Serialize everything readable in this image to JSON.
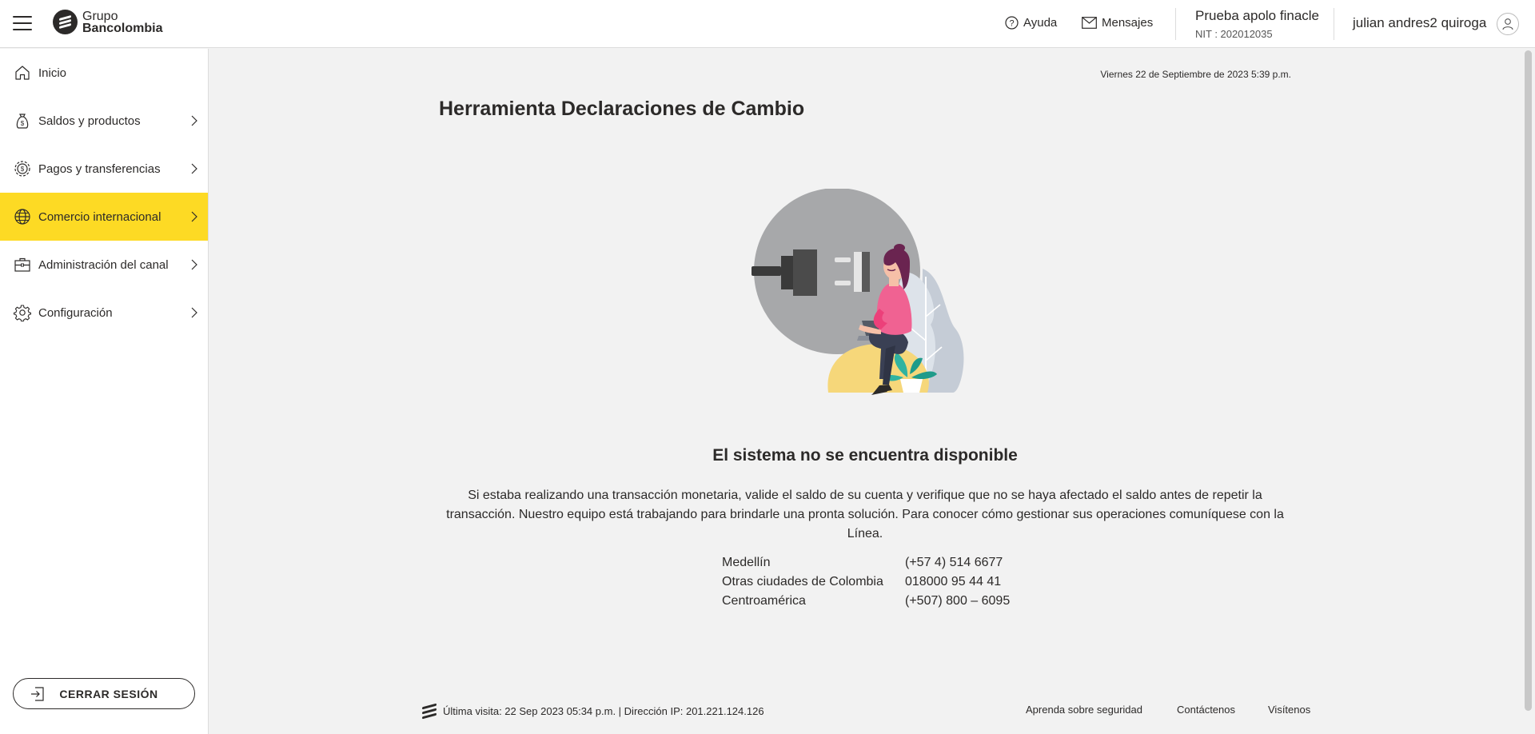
{
  "header": {
    "logo": {
      "line1": "Grupo",
      "line2": "Bancolombia"
    },
    "help_label": "Ayuda",
    "messages_label": "Mensajes",
    "company_name": "Prueba apolo finacle",
    "company_nit": "NIT : 202012035",
    "user_name": "julian andres2 quiroga"
  },
  "sidebar": {
    "items": [
      {
        "label": "Inicio",
        "icon": "home-icon"
      },
      {
        "label": "Saldos y productos",
        "icon": "money-bag-icon"
      },
      {
        "label": "Pagos y transferencias",
        "icon": "payments-gear-icon"
      },
      {
        "label": "Comercio internacional",
        "icon": "globe-icon",
        "active": true
      },
      {
        "label": "Administración del canal",
        "icon": "briefcase-icon"
      },
      {
        "label": "Configuración",
        "icon": "gear-icon"
      }
    ],
    "logout_label": "CERRAR SESIÓN"
  },
  "main": {
    "datetime": "Viernes 22 de Septiembre de 2023 5:39 p.m.",
    "title": "Herramienta Declaraciones de Cambio",
    "error_title": "El sistema no se encuentra disponible",
    "error_message": "Si estaba realizando una transacción monetaria, valide el saldo de su cuenta y verifique que no se haya afectado el saldo antes de repetir la transacción. Nuestro equipo está trabajando para brindarle una pronta solución. Para conocer cómo gestionar sus operaciones comuníquese con la Línea.",
    "contacts": [
      {
        "city": "Medellín",
        "phone": "(+57 4) 514 6677"
      },
      {
        "city": "Otras ciudades de Colombia",
        "phone": "018000 95 44 41"
      },
      {
        "city": "Centroamérica",
        "phone": "(+507) 800 – 6095"
      }
    ]
  },
  "footer": {
    "last_visit": "Última visita: 22 Sep 2023 05:34 p.m. | Dirección IP: 201.221.124.126",
    "links": [
      "Aprenda sobre seguridad",
      "Contáctenos",
      "Visítenos"
    ]
  },
  "colors": {
    "accent_yellow": "#fdda24",
    "text_dark": "#2c2a29",
    "background": "#f2f2f2"
  }
}
